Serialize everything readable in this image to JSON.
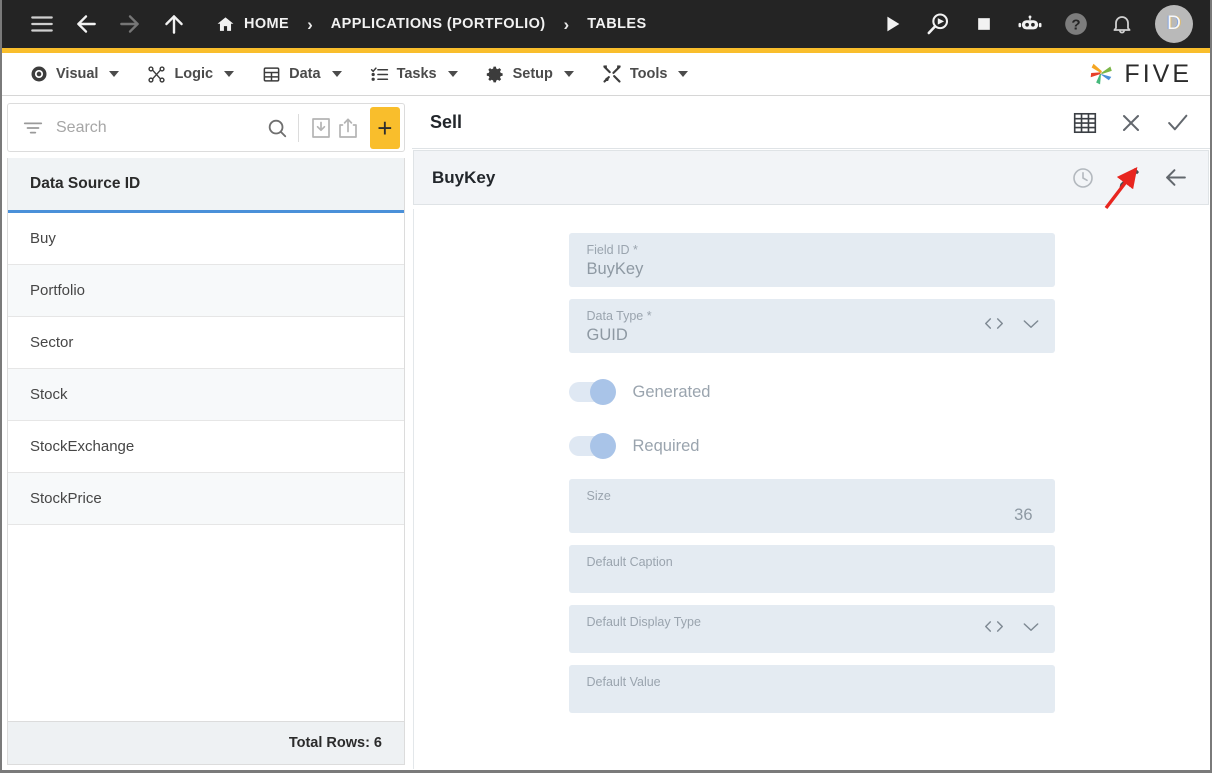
{
  "topbar": {
    "menu_icon": "hamburger-icon",
    "back_icon": "arrow-left-icon",
    "forward_icon": "arrow-right-icon",
    "up_icon": "arrow-up-icon",
    "breadcrumb": [
      {
        "label": "HOME",
        "icon": "home-icon"
      },
      {
        "label": "APPLICATIONS (PORTFOLIO)",
        "icon": ""
      },
      {
        "label": "TABLES",
        "icon": ""
      }
    ],
    "separator": "›",
    "actions": [
      {
        "name": "run-icon",
        "title": "Run"
      },
      {
        "name": "debug-icon",
        "title": "Debug"
      },
      {
        "name": "stop-icon",
        "title": "Stop"
      },
      {
        "name": "bot-icon",
        "title": "Assistant"
      },
      {
        "name": "help-icon",
        "title": "Help"
      },
      {
        "name": "bell-icon",
        "title": "Notifications"
      }
    ],
    "avatar_initial": "D",
    "bar_color": "#242424",
    "stripe_color": "#f9be2c"
  },
  "menubar": {
    "items": [
      {
        "label": "Visual",
        "icon": "eye-icon"
      },
      {
        "label": "Logic",
        "icon": "logic-nodes-icon"
      },
      {
        "label": "Data",
        "icon": "table-grid-icon"
      },
      {
        "label": "Tasks",
        "icon": "checklist-icon"
      },
      {
        "label": "Setup",
        "icon": "gear-icon"
      },
      {
        "label": "Tools",
        "icon": "tools-icon"
      }
    ],
    "brand": "FIVE"
  },
  "sidebar": {
    "search": {
      "placeholder": "Search",
      "filter_icon": "filter-icon",
      "search_icon": "search-icon",
      "import_icon": "import-icon",
      "export_icon": "export-icon",
      "add_label": "+"
    },
    "grid": {
      "column_header": "Data Source ID",
      "rows": [
        {
          "label": "Buy"
        },
        {
          "label": "Portfolio"
        },
        {
          "label": "Sector"
        },
        {
          "label": "Stock"
        },
        {
          "label": "StockExchange"
        },
        {
          "label": "StockPrice"
        }
      ],
      "footer": "Total Rows: 6",
      "header_underline_color": "#4a90d9"
    }
  },
  "detail": {
    "header": {
      "title": "Sell",
      "actions": [
        {
          "name": "table-view-icon"
        },
        {
          "name": "close-icon"
        },
        {
          "name": "confirm-check-icon"
        }
      ]
    },
    "subheader": {
      "title": "BuyKey",
      "actions": [
        {
          "name": "history-clock-icon"
        },
        {
          "name": "edit-pencil-icon"
        },
        {
          "name": "back-arrow-icon"
        }
      ]
    },
    "fields": [
      {
        "label": "Field ID *",
        "value": "BuyKey",
        "type": "text",
        "align": "left"
      },
      {
        "label": "Data Type *",
        "value": "GUID",
        "type": "select",
        "align": "left"
      },
      {
        "label": "Size",
        "value": "36",
        "type": "number",
        "align": "right"
      },
      {
        "label": "Default Caption",
        "value": "",
        "type": "text",
        "align": "left"
      },
      {
        "label": "Default Display Type",
        "value": "",
        "type": "select",
        "align": "left"
      },
      {
        "label": "Default Value",
        "value": "",
        "type": "text",
        "align": "left"
      }
    ],
    "toggles": [
      {
        "label": "Generated",
        "on": true
      },
      {
        "label": "Required",
        "on": true
      }
    ],
    "field_bg": "#e4ebf2"
  },
  "annotation": {
    "type": "arrow",
    "color": "#e8251f",
    "points_to": "edit-pencil-icon"
  }
}
